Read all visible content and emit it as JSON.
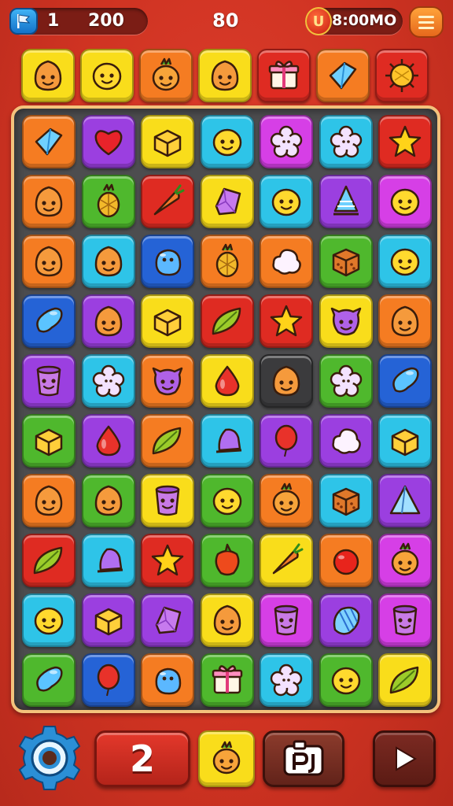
{
  "hud": {
    "level": "1",
    "score": "200",
    "moves": "80",
    "coins": "8:00MO",
    "coin_letter": "U",
    "flag_icon": "flag-icon",
    "menu_icon": "menu-icon"
  },
  "colors": {
    "orange": "#f57c22",
    "yellow": "#f9dd1b",
    "cyan": "#2ec4e8",
    "purple": "#9b3fe0",
    "green": "#4fb82d",
    "red": "#df2b22",
    "blue": "#2563d6",
    "magenta": "#d63fe6",
    "darkgray": "#3b3b3d"
  },
  "targets": [
    {
      "color": "yellow",
      "icon": "smiley-fruit-icon"
    },
    {
      "color": "yellow",
      "icon": "smiley-lemon-icon"
    },
    {
      "color": "orange",
      "icon": "smiley-pineapple-icon"
    },
    {
      "color": "yellow",
      "icon": "smiley-fruit-icon"
    },
    {
      "color": "red",
      "icon": "gift-box-icon"
    },
    {
      "color": "orange",
      "icon": "ice-block-icon"
    },
    {
      "color": "red",
      "icon": "sun-fruit-icon"
    }
  ],
  "board": [
    [
      {
        "color": "orange",
        "icon": "ice-block-icon"
      },
      {
        "color": "purple",
        "icon": "heart-icon"
      },
      {
        "color": "yellow",
        "icon": "cube-icon"
      },
      {
        "color": "cyan",
        "icon": "smiley-lemon-icon"
      },
      {
        "color": "magenta",
        "icon": "flower-icon"
      },
      {
        "color": "cyan",
        "icon": "flower-icon"
      },
      {
        "color": "red",
        "icon": "star-icon"
      }
    ],
    [
      {
        "color": "orange",
        "icon": "smiley-fruit-icon"
      },
      {
        "color": "green",
        "icon": "pineapple-icon"
      },
      {
        "color": "red",
        "icon": "carrot-icon"
      },
      {
        "color": "yellow",
        "icon": "gem-icon"
      },
      {
        "color": "cyan",
        "icon": "smiley-lemon-icon"
      },
      {
        "color": "purple",
        "icon": "sail-icon"
      },
      {
        "color": "magenta",
        "icon": "smiley-lemon-icon"
      }
    ],
    [
      {
        "color": "orange",
        "icon": "smiley-fruit-icon"
      },
      {
        "color": "cyan",
        "icon": "smiley-fruit-icon"
      },
      {
        "color": "blue",
        "icon": "blob-icon"
      },
      {
        "color": "orange",
        "icon": "pineapple-icon"
      },
      {
        "color": "orange",
        "icon": "cloud-icon"
      },
      {
        "color": "green",
        "icon": "crate-icon"
      },
      {
        "color": "cyan",
        "icon": "smiley-lemon-icon"
      }
    ],
    [
      {
        "color": "blue",
        "icon": "bean-icon"
      },
      {
        "color": "purple",
        "icon": "smiley-fruit-icon"
      },
      {
        "color": "yellow",
        "icon": "cube-icon"
      },
      {
        "color": "red",
        "icon": "leaf-icon"
      },
      {
        "color": "red",
        "icon": "star-icon"
      },
      {
        "color": "yellow",
        "icon": "smiley-monster-icon"
      },
      {
        "color": "orange",
        "icon": "smiley-fruit-icon"
      }
    ],
    [
      {
        "color": "purple",
        "icon": "smiley-cup-icon"
      },
      {
        "color": "cyan",
        "icon": "flower-icon"
      },
      {
        "color": "orange",
        "icon": "smiley-monster-icon"
      },
      {
        "color": "yellow",
        "icon": "drop-icon"
      },
      {
        "color": "darkgray",
        "icon": "smiley-fruit-icon"
      },
      {
        "color": "green",
        "icon": "flower-icon"
      },
      {
        "color": "blue",
        "icon": "bean-icon"
      }
    ],
    [
      {
        "color": "green",
        "icon": "cube-icon"
      },
      {
        "color": "purple",
        "icon": "drop-icon"
      },
      {
        "color": "orange",
        "icon": "leaf-icon"
      },
      {
        "color": "cyan",
        "icon": "bell-icon"
      },
      {
        "color": "purple",
        "icon": "balloon-icon"
      },
      {
        "color": "purple",
        "icon": "cloud-icon"
      },
      {
        "color": "cyan",
        "icon": "cube-icon"
      }
    ],
    [
      {
        "color": "orange",
        "icon": "smiley-fruit-icon"
      },
      {
        "color": "green",
        "icon": "smiley-fruit-icon"
      },
      {
        "color": "yellow",
        "icon": "smiley-cup-icon"
      },
      {
        "color": "green",
        "icon": "smiley-lemon-icon"
      },
      {
        "color": "orange",
        "icon": "smiley-pineapple-icon"
      },
      {
        "color": "cyan",
        "icon": "crate-icon"
      },
      {
        "color": "purple",
        "icon": "pyramid-icon"
      }
    ],
    [
      {
        "color": "red",
        "icon": "leaf-icon"
      },
      {
        "color": "cyan",
        "icon": "bell-icon"
      },
      {
        "color": "red",
        "icon": "star-icon"
      },
      {
        "color": "green",
        "icon": "pepper-icon"
      },
      {
        "color": "yellow",
        "icon": "carrot-icon"
      },
      {
        "color": "orange",
        "icon": "tomato-icon"
      },
      {
        "color": "magenta",
        "icon": "smiley-pineapple-icon"
      }
    ],
    [
      {
        "color": "cyan",
        "icon": "smiley-lemon-icon"
      },
      {
        "color": "purple",
        "icon": "cube-icon"
      },
      {
        "color": "purple",
        "icon": "gem-icon"
      },
      {
        "color": "yellow",
        "icon": "smiley-fruit-icon"
      },
      {
        "color": "magenta",
        "icon": "smiley-cup-icon"
      },
      {
        "color": "purple",
        "icon": "shell-icon"
      },
      {
        "color": "magenta",
        "icon": "smiley-cup-icon"
      }
    ],
    [
      {
        "color": "green",
        "icon": "bean-icon"
      },
      {
        "color": "blue",
        "icon": "balloon-icon"
      },
      {
        "color": "orange",
        "icon": "blob-icon"
      },
      {
        "color": "green",
        "icon": "gift-box-icon"
      },
      {
        "color": "cyan",
        "icon": "flower-icon"
      },
      {
        "color": "green",
        "icon": "smiley-lemon-icon"
      },
      {
        "color": "yellow",
        "icon": "leaf-icon"
      }
    ]
  ],
  "bottom": {
    "booster_count": "2",
    "settings_icon": "gear-icon",
    "piece_icon": "smiley-pineapple-icon",
    "photo_icon": "camera-icon",
    "play_icon": "play-icon"
  }
}
